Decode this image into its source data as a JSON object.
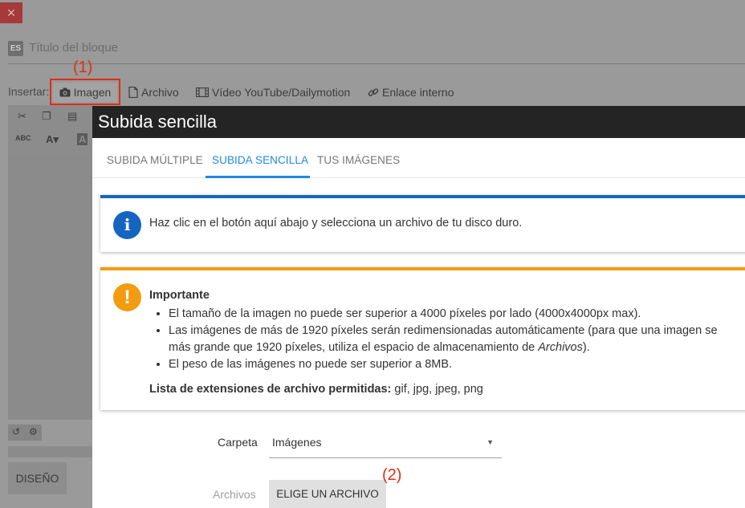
{
  "background": {
    "close_glyph": "×",
    "lang_badge": "ES",
    "block_title_placeholder": "Título del bloque",
    "insert_label": "Insertar:",
    "insert_buttons": {
      "image": "Imagen",
      "file": "Archivo",
      "video": "Vídeo YouTube/Dailymotion",
      "link": "Enlace interno"
    },
    "design_button": "DISEÑO"
  },
  "annotations": {
    "one": "(1)",
    "two": "(2)"
  },
  "modal": {
    "title": "Subida sencilla",
    "tabs": [
      "SUBIDA MÚLTIPLE",
      "SUBIDA SENCILLA",
      "TUS IMÁGENES"
    ],
    "active_tab": "SUBIDA SENCILLA",
    "info": {
      "icon": "info-icon",
      "text": "Haz clic en el botón aquí abajo y selecciona un archivo de tu disco duro."
    },
    "warning": {
      "icon": "warning-icon",
      "title": "Importante",
      "items": [
        "El tamaño de la imagen no puede ser superior a 4000 píxeles por lado (4000x4000px max).",
        "Las imágenes de más de 1920 píxeles serán redimensionadas automáticamente (para que una imagen se",
        "más grande que 1920 píxeles, utiliza el espacio de almacenamiento de",
        "Archivos",
        ").",
        "El peso de las imágenes no puede ser superior a 8MB."
      ],
      "extensions_label": "Lista de extensiones de archivo permitidas:",
      "extensions_value": " gif, jpg, jpeg, png"
    },
    "folder_label": "Carpeta",
    "folder_value": "Imágenes",
    "files_label": "Archivos",
    "choose_button": "ELIGE UN ARCHIVO"
  },
  "colors": {
    "accent": "#1e88e5",
    "info": "#1565c0",
    "warning": "#f39c12",
    "annotation": "#e02e14",
    "header": "#242424"
  }
}
